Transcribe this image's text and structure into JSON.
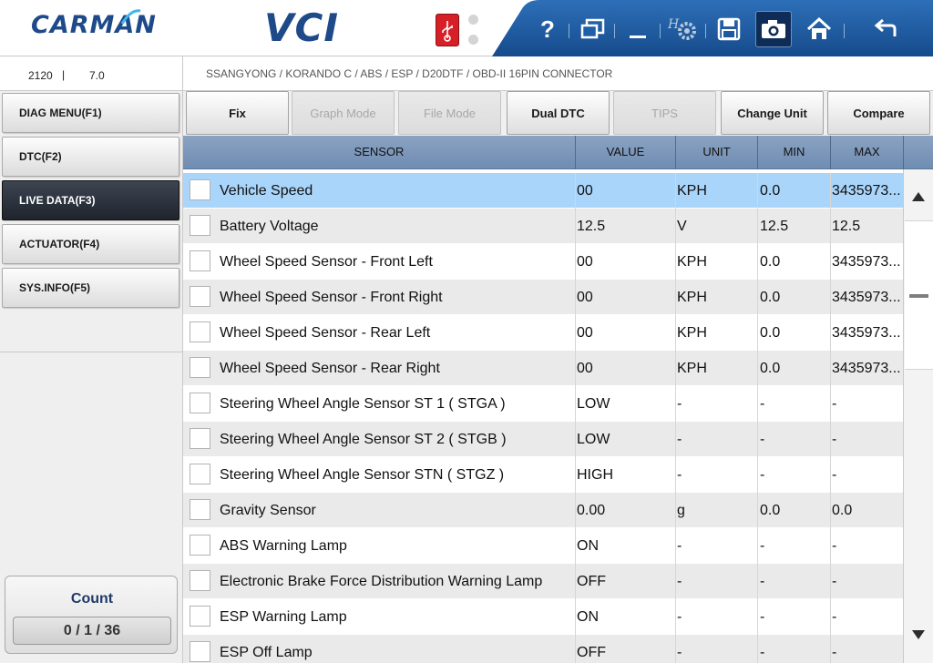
{
  "header": {
    "logo_text": "CARMAN",
    "title": "VCI",
    "colors": {
      "brand": "#1f4a8a",
      "toolbar": "#1f5fa8",
      "usb": "#d61f26"
    },
    "toolbar_icons": [
      "help-icon",
      "window-icon",
      "minimize-icon",
      "settings-icon",
      "save-icon",
      "camera-icon",
      "home-icon",
      "back-icon"
    ],
    "help_label": "?",
    "settings_label": "H"
  },
  "info": {
    "code": "2120",
    "separator": "|",
    "version": "7.0",
    "breadcrumb": "SSANGYONG / KORANDO C / ABS / ESP / D20DTF / OBD-II 16PIN CONNECTOR"
  },
  "sidebar": {
    "items": [
      {
        "label": "DIAG MENU(F1)"
      },
      {
        "label": "DTC(F2)"
      },
      {
        "label": "LIVE DATA(F3)",
        "active": true
      },
      {
        "label": "ACTUATOR(F4)"
      },
      {
        "label": "SYS.INFO(F5)"
      }
    ],
    "count_label": "Count",
    "count_value": "0 / 1 / 36"
  },
  "functions": {
    "buttons": [
      {
        "label": "Fix",
        "enabled": true
      },
      {
        "label": "Graph Mode",
        "enabled": false
      },
      {
        "label": "File Mode",
        "enabled": false
      },
      {
        "label": "Dual DTC",
        "enabled": true
      },
      {
        "label": "TIPS",
        "enabled": false
      },
      {
        "label": "Change Unit",
        "enabled": true
      },
      {
        "label": "Compare",
        "enabled": true
      }
    ]
  },
  "table": {
    "headers": {
      "sensor": "SENSOR",
      "value": "VALUE",
      "unit": "UNIT",
      "min": "MIN",
      "max": "MAX"
    },
    "rows": [
      {
        "sensor": "Vehicle Speed",
        "value": "00",
        "unit": "KPH",
        "min": "0.0",
        "max": "3435973...",
        "selected": true
      },
      {
        "sensor": "Battery Voltage",
        "value": "12.5",
        "unit": "V",
        "min": "12.5",
        "max": "12.5"
      },
      {
        "sensor": "Wheel Speed Sensor - Front Left",
        "value": "00",
        "unit": "KPH",
        "min": "0.0",
        "max": "3435973..."
      },
      {
        "sensor": "Wheel Speed Sensor - Front Right",
        "value": "00",
        "unit": "KPH",
        "min": "0.0",
        "max": "3435973..."
      },
      {
        "sensor": "Wheel Speed Sensor - Rear Left",
        "value": "00",
        "unit": "KPH",
        "min": "0.0",
        "max": "3435973..."
      },
      {
        "sensor": "Wheel Speed Sensor - Rear Right",
        "value": "00",
        "unit": "KPH",
        "min": "0.0",
        "max": "3435973..."
      },
      {
        "sensor": "Steering Wheel Angle Sensor ST 1 ( STGA )",
        "value": "LOW",
        "unit": "-",
        "min": "-",
        "max": "-"
      },
      {
        "sensor": "Steering Wheel Angle Sensor ST 2 ( STGB )",
        "value": "LOW",
        "unit": "-",
        "min": "-",
        "max": "-"
      },
      {
        "sensor": "Steering Wheel Angle Sensor STN ( STGZ )",
        "value": "HIGH",
        "unit": "-",
        "min": "-",
        "max": "-"
      },
      {
        "sensor": "Gravity Sensor",
        "value": "0.00",
        "unit": "g",
        "min": "0.0",
        "max": "0.0"
      },
      {
        "sensor": "ABS Warning Lamp",
        "value": "ON",
        "unit": "-",
        "min": "-",
        "max": "-"
      },
      {
        "sensor": "Electronic Brake Force Distribution Warning Lamp",
        "value": "OFF",
        "unit": "-",
        "min": "-",
        "max": "-"
      },
      {
        "sensor": "ESP Warning Lamp",
        "value": "ON",
        "unit": "-",
        "min": "-",
        "max": "-"
      },
      {
        "sensor": "ESP Off Lamp",
        "value": "OFF",
        "unit": "-",
        "min": "-",
        "max": "-"
      }
    ]
  },
  "scrollbar": {
    "up_icon": "triangle-up-icon",
    "down_icon": "triangle-down-icon"
  }
}
